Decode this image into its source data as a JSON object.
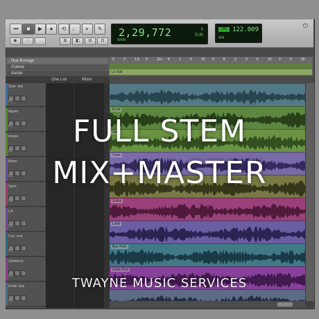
{
  "transport": {
    "counter_main": "2,29,772",
    "counter_sub": "MAIN",
    "counter_right_top": "0",
    "counter_right_bottom": "SUB",
    "tempo_bpm": "122.009",
    "tempo_sig": "4/4",
    "tempo_led": "ON"
  },
  "header": {
    "row1": "Nue Bunage",
    "row2": "Coiene",
    "row3": "Auicle",
    "lane_label": "Lo Suit",
    "ruler_ticks": [
      "2",
      "2",
      "1.5",
      "6",
      "11s",
      "6",
      "1",
      "5",
      "15",
      "6",
      "8",
      "2",
      "2",
      "6",
      "10",
      "2",
      "9",
      "25"
    ]
  },
  "columns": {
    "one_list": "One List",
    "mixer": "Mixer"
  },
  "tracks": [
    {
      "name": "Srae· iets",
      "io": "G1",
      "color": "#4b7fb5"
    },
    {
      "name": "Aqpes",
      "io": "G1",
      "color": "#6a9a3a"
    },
    {
      "name": "Aneps",
      "io": "G1",
      "color": "#6a9a3a"
    },
    {
      "name": "Blnne",
      "io": "G1",
      "color": "#7a5cb0"
    },
    {
      "name": "Sprin",
      "io": "G4",
      "color": "#b04a7a"
    },
    {
      "name": "Lilc",
      "io": "G3",
      "color": "#7a5cb0"
    },
    {
      "name": "Cun ·ene",
      "io": "G1",
      "color": "#3a7a8a"
    },
    {
      "name": "Gilshlecm",
      "io": "G1",
      "color": "#a04aa0"
    },
    {
      "name": "Emdn Sus",
      "io": "G1",
      "color": "#5a7a9a"
    }
  ],
  "regions": [
    {
      "label": "",
      "color": "#5f8a9a",
      "wave": "#2e4e5a"
    },
    {
      "label": "Ecnd",
      "color": "#6a9a4a",
      "wave": "#2e4a1e"
    },
    {
      "label": "Sthe",
      "color": "#7aa84e",
      "wave": "#3a5a24"
    },
    {
      "label": "Coes",
      "color": "#8a7ac0",
      "wave": "#3e2f6a"
    },
    {
      "label": "",
      "color": "#8a8a50",
      "wave": "#3e3e1e"
    },
    {
      "label": "Sclinc",
      "color": "#b04a8a",
      "wave": "#5a1e44"
    },
    {
      "label": "Lsnd",
      "color": "#7a6ab8",
      "wave": "#33285e"
    },
    {
      "label": "Bne Pont",
      "color": "#4a8a9a",
      "wave": "#1e4450"
    },
    {
      "label": "Lines Poxt",
      "color": "#9a4ab0",
      "wave": "#4a1e5a"
    },
    {
      "label": "",
      "color": "#6a7a9a",
      "wave": "#2a3448"
    }
  ],
  "overlay": {
    "line1": "FULL STEM",
    "line2": "MIX+MASTER",
    "footer": "TWAYNE MUSIC SERVICES"
  }
}
